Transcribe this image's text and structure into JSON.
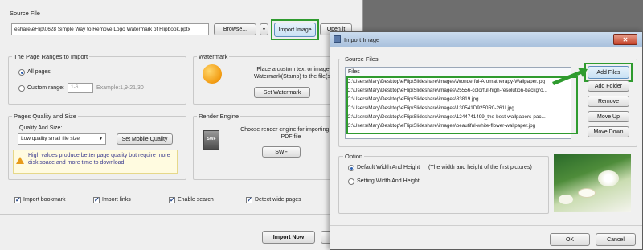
{
  "main": {
    "source_file": {
      "group_title": "Source File",
      "path": "eshare\\eFlip\\0628 Simple Way to Remove Logo Watermark of Flipbook.pptx",
      "browse_label": "Browse...",
      "dropdown_glyph": "▼",
      "import_image_label": "Import Image",
      "open_it_label": "Open it"
    },
    "page_ranges": {
      "group_title": "The Page Ranges to Import",
      "all_pages_label": "All pages",
      "custom_range_label": "Custom range:",
      "custom_range_value": "1-6",
      "example_text": "Example:1,9-21,30"
    },
    "watermark": {
      "group_title": "Watermark",
      "description": "Place a custom text or image Watermark(Stamp) to the file(s)",
      "set_watermark_label": "Set Watermark"
    },
    "quality": {
      "group_title": "Pages Quality and Size",
      "quality_label": "Quality And Size:",
      "selected_option": "Low quality small file size",
      "set_mobile_label": "Set Mobile Quality",
      "warning_text": "High values produce better page quality but require more disk space and more time to download."
    },
    "render_engine": {
      "group_title": "Render Engine",
      "description": "Choose render engine for importing your PDF file",
      "swf_label": "SWF",
      "swf_icon_text": "SWF"
    },
    "options": {
      "import_bookmark": "Import bookmark",
      "import_links": "Import links",
      "enable_search": "Enable search",
      "detect_wide_pages": "Detect wide pages"
    },
    "import_now_label": "Import Now"
  },
  "dialog": {
    "title": "Import Image",
    "close_glyph": "✕",
    "source_files_title": "Source Files",
    "files_header": "Files",
    "files": [
      "C:\\Users\\Mary\\Desktop\\eFlip\\Slideshare\\images\\Wonderful-Aromatherapy-Wallpaper.jpg",
      "C:\\Users\\Mary\\Desktop\\eFlip\\Slideshare\\images\\25556-colorful-high-resolution-backgro...",
      "C:\\Users\\Mary\\Desktop\\eFlip\\Slideshare\\images\\83819.jpg",
      "C:\\Users\\Mary\\Desktop\\eFlip\\Slideshare\\images\\130541D9250R0-261I.jpg",
      "C:\\Users\\Mary\\Desktop\\eFlip\\Slideshare\\images\\1244741499_the-best-wallpapers-pac...",
      "C:\\Users\\Mary\\Desktop\\eFlip\\Slideshare\\images\\beautiful-white-flower-wallpaper.jpg"
    ],
    "buttons": {
      "add_files": "Add Files",
      "add_folder": "Add Folder",
      "remove": "Remove",
      "move_up": "Move Up",
      "move_down": "Move Down"
    },
    "option_title": "Option",
    "default_size_label": "Default Width And Height",
    "default_size_note": "(The width and height of the first pictures)",
    "setting_size_label": "Setting Width And Height",
    "ok_label": "OK",
    "cancel_label": "Cancel"
  },
  "colors": {
    "highlight_green": "#2f9b2f",
    "dialog_titlebar": "#b5cbe4",
    "background_dark": "#6e6e6e"
  }
}
